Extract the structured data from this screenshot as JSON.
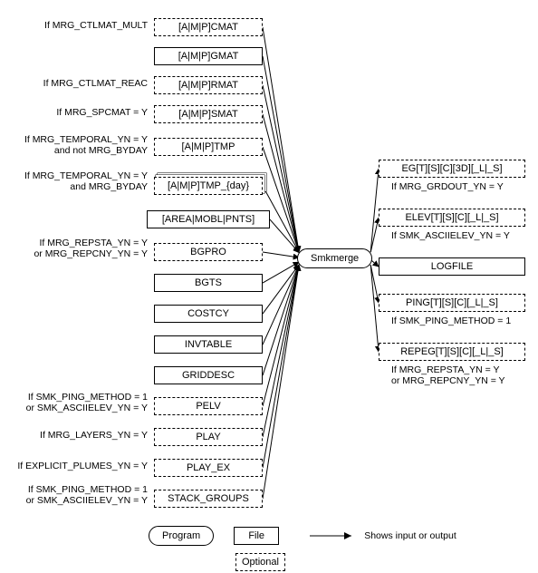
{
  "program": {
    "label": "Smkmerge"
  },
  "inputs": [
    {
      "key": "cmat",
      "label": "[A|M|P]CMAT",
      "optional": true,
      "cond": "If MRG_CTLMAT_MULT"
    },
    {
      "key": "gmat",
      "label": "[A|M|P]GMAT",
      "optional": false,
      "cond": ""
    },
    {
      "key": "rmat",
      "label": "[A|M|P]RMAT",
      "optional": true,
      "cond": "If MRG_CTLMAT_REAC"
    },
    {
      "key": "smat",
      "label": "[A|M|P]SMAT",
      "optional": true,
      "cond": "If MRG_SPCMAT = Y"
    },
    {
      "key": "tmp",
      "label": "[A|M|P]TMP",
      "optional": true,
      "cond": "If MRG_TEMPORAL_YN = Y\nand not MRG_BYDAY"
    },
    {
      "key": "tmpday",
      "label": "[A|M|P]TMP_{day}",
      "optional": true,
      "cond": "If MRG_TEMPORAL_YN = Y\nand MRG_BYDAY",
      "stack": true
    },
    {
      "key": "amp",
      "label": "[AREA|MOBL|PNTS]",
      "optional": false,
      "cond": ""
    },
    {
      "key": "bgpro",
      "label": "BGPRO",
      "optional": true,
      "cond": "If MRG_REPSTA_YN = Y\nor MRG_REPCNY_YN = Y"
    },
    {
      "key": "bgts",
      "label": "BGTS",
      "optional": false,
      "cond": ""
    },
    {
      "key": "costcy",
      "label": "COSTCY",
      "optional": false,
      "cond": ""
    },
    {
      "key": "invtab",
      "label": "INVTABLE",
      "optional": false,
      "cond": ""
    },
    {
      "key": "griddesc",
      "label": "GRIDDESC",
      "optional": false,
      "cond": ""
    },
    {
      "key": "pelv",
      "label": "PELV",
      "optional": true,
      "cond": "If SMK_PING_METHOD = 1\nor SMK_ASCIIELEV_YN = Y"
    },
    {
      "key": "play",
      "label": "PLAY",
      "optional": true,
      "cond": "If MRG_LAYERS_YN = Y"
    },
    {
      "key": "playex",
      "label": "PLAY_EX",
      "optional": true,
      "cond": "If EXPLICIT_PLUMES_YN = Y"
    },
    {
      "key": "stackg",
      "label": "STACK_GROUPS",
      "optional": true,
      "cond": "If SMK_PING_METHOD = 1\nor SMK_ASCIIELEV_YN = Y"
    }
  ],
  "outputs": [
    {
      "key": "eg",
      "label": "EG[T][S][C][3D][_L|_S]",
      "optional": true,
      "cond": "If MRG_GRDOUT_YN = Y",
      "condBelow": true
    },
    {
      "key": "elev",
      "label": "ELEV[T][S][C][_L|_S]",
      "optional": true,
      "cond": "If SMK_ASCIIELEV_YN = Y",
      "condBelow": true
    },
    {
      "key": "log",
      "label": "LOGFILE",
      "optional": false,
      "cond": ""
    },
    {
      "key": "ping",
      "label": "PING[T][S][C][_L|_S]",
      "optional": true,
      "cond": "If SMK_PING_METHOD = 1",
      "condBelow": true
    },
    {
      "key": "repeg",
      "label": "REPEG[T][S][C][_L|_S]",
      "optional": true,
      "cond": "If MRG_REPSTA_YN = Y\nor MRG_REPCNY_YN = Y",
      "condBelow": true
    }
  ],
  "legend": {
    "program": "Program",
    "file": "File",
    "optional": "Optional",
    "arrow": "Shows input or output"
  }
}
